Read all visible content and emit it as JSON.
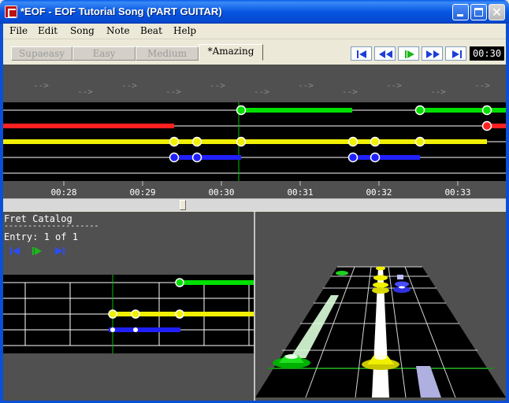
{
  "window": {
    "title": "*EOF - EOF Tutorial Song (PART GUITAR)",
    "close_glyph": "✕"
  },
  "menu": [
    "File",
    "Edit",
    "Song",
    "Note",
    "Beat",
    "Help"
  ],
  "difficulty_tabs": [
    {
      "label": "Supaeasy",
      "active": false
    },
    {
      "label": "Easy",
      "active": false
    },
    {
      "label": "Medium",
      "active": false
    },
    {
      "label": "*Amazing",
      "active": true
    }
  ],
  "transport": {
    "buttons": [
      "skip-to-start-icon",
      "rewind-icon",
      "play-icon",
      "fast-forward-icon",
      "skip-to-end-icon"
    ],
    "time": "00:30"
  },
  "timeline": {
    "time_labels": [
      "00:28",
      "00:29",
      "00:30",
      "00:31",
      "00:32",
      "00:33"
    ],
    "beat_marker": "-->",
    "lane_colors": {
      "green": "#00e000",
      "red": "#ff2020",
      "yellow": "#f0f000",
      "blue": "#2020ff"
    }
  },
  "catalog": {
    "title": "Fret Catalog",
    "separator": "--------------------",
    "entry": "Entry: 1 of 1",
    "buttons": [
      "previous-entry-icon",
      "play-entry-icon",
      "next-entry-icon"
    ]
  },
  "icons": {
    "app": "eof-app-icon",
    "minimize": "minimize-icon",
    "maximize": "maximize-icon",
    "close": "close-icon"
  }
}
